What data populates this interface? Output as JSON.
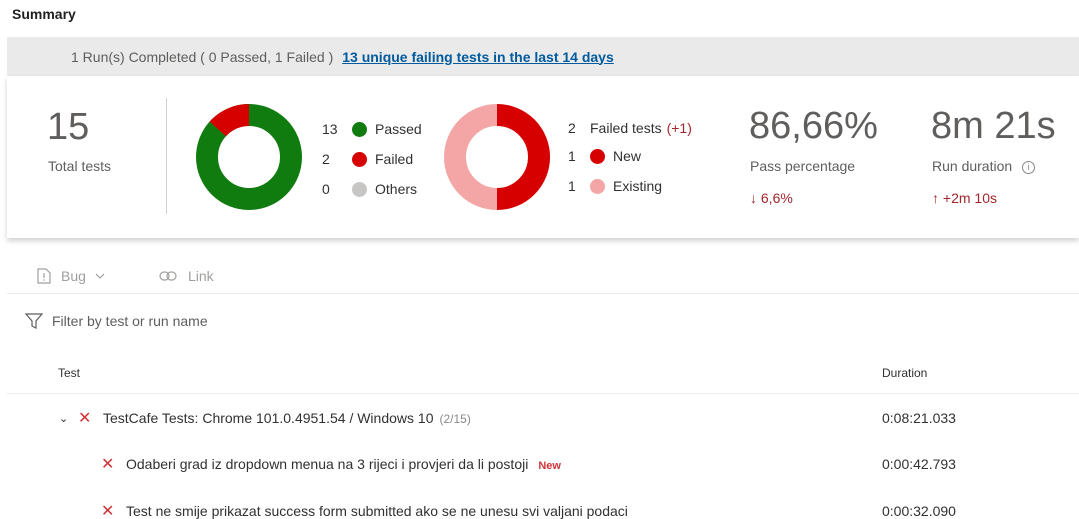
{
  "title": "Summary",
  "banner": {
    "text": "1 Run(s) Completed ( 0 Passed, 1 Failed )",
    "link": "13 unique failing tests in the last 14 days"
  },
  "total": {
    "value": "15",
    "label": "Total tests"
  },
  "outcome": {
    "passed_count": "13",
    "passed_label": "Passed",
    "failed_count": "2",
    "failed_label": "Failed",
    "others_count": "0",
    "others_label": "Others",
    "colors": {
      "passed": "#107c10",
      "failed": "#d70000",
      "others": "#c8c6c4"
    }
  },
  "failed_breakdown": {
    "total_count": "2",
    "total_label": "Failed tests",
    "total_delta": "(+1)",
    "new_count": "1",
    "new_label": "New",
    "existing_count": "1",
    "existing_label": "Existing",
    "colors": {
      "new": "#d70000",
      "existing": "#f4a6a6"
    }
  },
  "pass_percentage": {
    "value": "86,66%",
    "label": "Pass percentage",
    "delta": "6,6%",
    "delta_direction": "down"
  },
  "run_duration": {
    "value": "8m 21s",
    "label": "Run duration",
    "delta": "+2m 10s",
    "delta_direction": "up"
  },
  "toolbar": {
    "bug_label": "Bug",
    "link_label": "Link"
  },
  "filter": {
    "placeholder": "Filter by test or run name"
  },
  "columns": {
    "test": "Test",
    "duration": "Duration"
  },
  "rows": [
    {
      "name": "TestCafe Tests: Chrome 101.0.4951.54 / Windows 10",
      "count": "(2/15)",
      "duration": "0:08:21.033"
    },
    {
      "name": "Odaberi grad iz dropdown menua na 3 rijeci i provjeri da li postoji",
      "badge": "New",
      "duration": "0:00:42.793"
    },
    {
      "name": "Test ne smije prikazat success form submitted ako se ne unesu svi valjani podaci",
      "duration": "0:00:32.090"
    }
  ]
}
